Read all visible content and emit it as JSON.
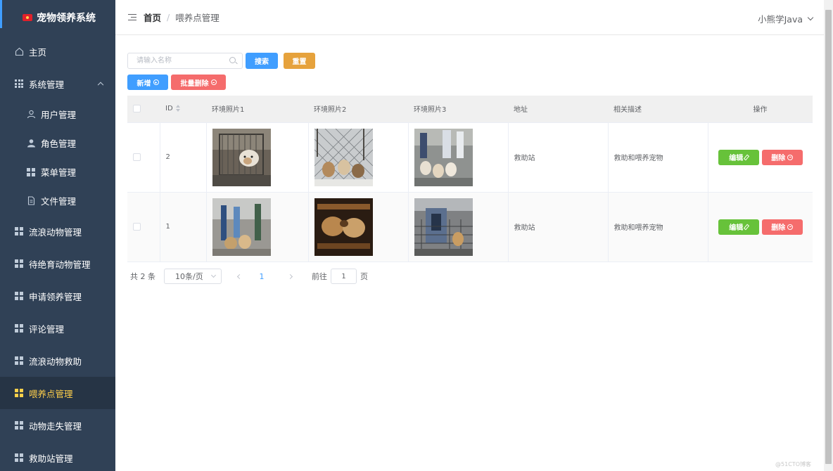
{
  "app": {
    "title": "宠物领养系统"
  },
  "sidebar": {
    "items": [
      {
        "label": "主页"
      },
      {
        "label": "系统管理"
      },
      {
        "label": "用户管理"
      },
      {
        "label": "角色管理"
      },
      {
        "label": "菜单管理"
      },
      {
        "label": "文件管理"
      },
      {
        "label": "流浪动物管理"
      },
      {
        "label": "待绝育动物管理"
      },
      {
        "label": "申请领养管理"
      },
      {
        "label": "评论管理"
      },
      {
        "label": "流浪动物救助"
      },
      {
        "label": "喂养点管理"
      },
      {
        "label": "动物走失管理"
      },
      {
        "label": "救助站管理"
      }
    ],
    "active_color": "#ffd04b",
    "bg_color": "#304156"
  },
  "header": {
    "breadcrumb": {
      "home": "首页",
      "separator": "/",
      "current": "喂养点管理"
    },
    "user": "小熊学Java"
  },
  "toolbar": {
    "search_placeholder": "请输入名称",
    "search_label": "搜索",
    "reset_label": "重置",
    "add_label": "新增",
    "batch_delete_label": "批量删除"
  },
  "table": {
    "columns": [
      "ID",
      "环境照片1",
      "环境照片2",
      "环境照片3",
      "地址",
      "相关描述",
      "操作"
    ],
    "rows": [
      {
        "id": "2",
        "address": "救助站",
        "description": "救助和喂养宠物",
        "edit_label": "编辑",
        "delete_label": "删除"
      },
      {
        "id": "1",
        "address": "救助站",
        "description": "救助和喂养宠物",
        "edit_label": "编辑",
        "delete_label": "删除"
      }
    ]
  },
  "pagination": {
    "total": "共 2 条",
    "page_size": "10条/页",
    "current_page": "1",
    "goto_label": "前往",
    "goto_value": "1",
    "page_suffix": "页"
  },
  "watermark": "@51CTO博客",
  "colors": {
    "primary": "#409eff",
    "warning": "#e6a23c",
    "danger": "#f56c6c",
    "success": "#67c23a"
  }
}
